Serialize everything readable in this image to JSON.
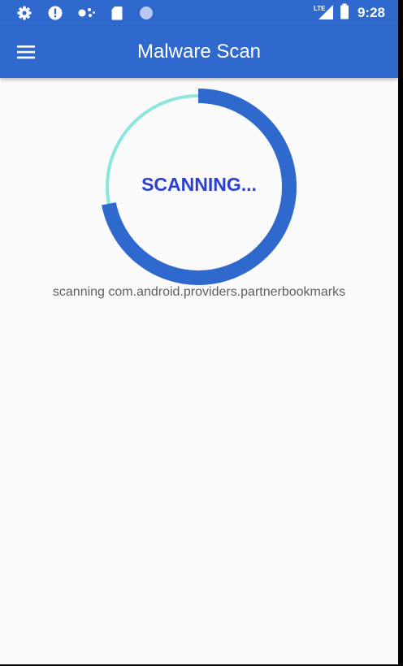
{
  "status_bar": {
    "time": "9:28",
    "network_label": "LTE",
    "icons": [
      "settings-icon",
      "alert-icon",
      "network-dots-icon",
      "sd-card-icon",
      "circle-notification-icon",
      "signal-icon",
      "battery-icon"
    ]
  },
  "app_bar": {
    "title": "Malware Scan",
    "menu_icon": "hamburger-menu-icon"
  },
  "scan": {
    "status_text": "SCANNING...",
    "detail_text": "scanning com.android.providers.partnerbookmarks",
    "progress_fraction": 0.72
  },
  "colors": {
    "primary": "#2f69cd",
    "progress_fill": "#2f69cd",
    "progress_track": "#8be6de",
    "status_text": "#2b3fd0",
    "background": "#fafafa",
    "detail_text": "#5f5f5f"
  }
}
